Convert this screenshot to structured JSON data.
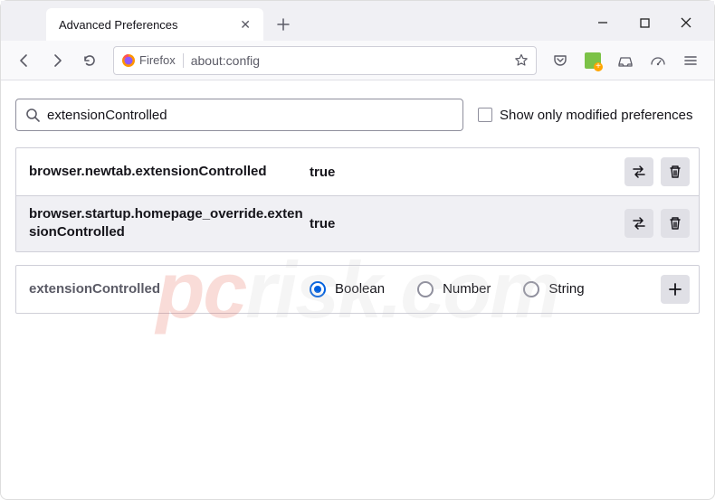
{
  "window": {
    "tab_title": "Advanced Preferences"
  },
  "urlbar": {
    "identity_label": "Firefox",
    "url": "about:config"
  },
  "search": {
    "value": "extensionControlled",
    "checkbox_label": "Show only modified preferences"
  },
  "prefs": [
    {
      "name": "browser.newtab.extensionControlled",
      "value": "true"
    },
    {
      "name": "browser.startup.homepage_override.extensionControlled",
      "value": "true"
    }
  ],
  "new_pref": {
    "name": "extensionControlled",
    "types": {
      "boolean": "Boolean",
      "number": "Number",
      "string": "String"
    }
  },
  "watermark": {
    "brand": "pc",
    "domain": "risk.com"
  }
}
